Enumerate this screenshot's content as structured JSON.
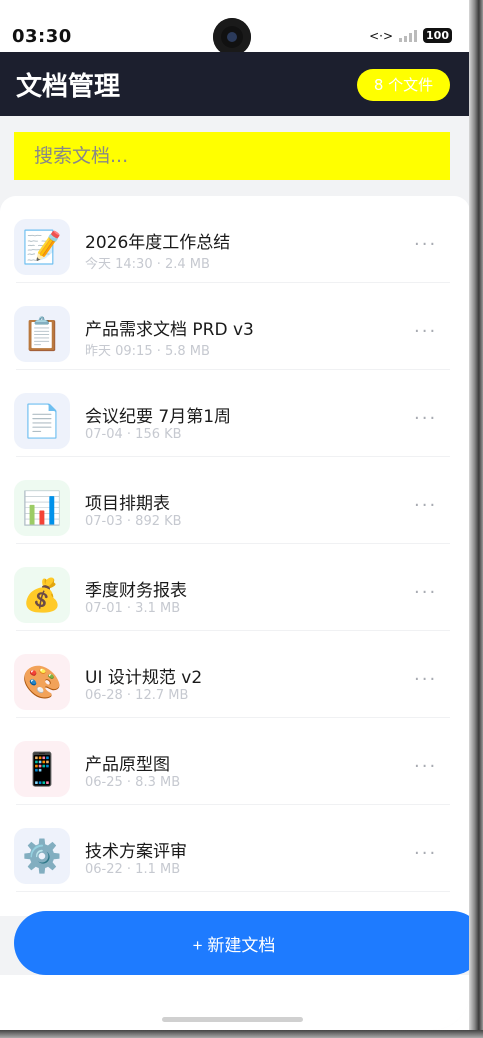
{
  "status_bar": {
    "time": "03:30",
    "signal_prefix": "<·>",
    "battery": "100"
  },
  "header": {
    "title": "文档管理",
    "file_count": "8 个文件"
  },
  "search": {
    "placeholder": "搜索文档..."
  },
  "files": [
    {
      "name": "2026年度工作总结",
      "meta": "今天 14:30 · 2.4 MB",
      "icon": "memo-icon",
      "glyph": "📝",
      "tint": "#eef2fb"
    },
    {
      "name": "产品需求文档 PRD v3",
      "meta": "昨天 09:15 · 5.8 MB",
      "icon": "clipboard-icon",
      "glyph": "📋",
      "tint": "#eef2fb"
    },
    {
      "name": "会议纪要 7月第1周",
      "meta": "07-04 · 156 KB",
      "icon": "page-icon",
      "glyph": "📄",
      "tint": "#eef2fb"
    },
    {
      "name": "项目排期表",
      "meta": "07-03 · 892 KB",
      "icon": "bar-chart-icon",
      "glyph": "📊",
      "tint": "#eefaf1"
    },
    {
      "name": "季度财务报表",
      "meta": "07-01 · 3.1 MB",
      "icon": "money-bag-icon",
      "glyph": "💰",
      "tint": "#eefaf1"
    },
    {
      "name": "UI 设计规范 v2",
      "meta": "06-28 · 12.7 MB",
      "icon": "palette-icon",
      "glyph": "🎨",
      "tint": "#fdf0f3"
    },
    {
      "name": "产品原型图",
      "meta": "06-25 · 8.3 MB",
      "icon": "mobile-phone-icon",
      "glyph": "📱",
      "tint": "#fdf0f3"
    },
    {
      "name": "技术方案评审",
      "meta": "06-22 · 1.1 MB",
      "icon": "gear-icon",
      "glyph": "⚙️",
      "tint": "#eef2fb"
    }
  ],
  "more_label": "···",
  "new_button": {
    "label": "+ 新建文档"
  }
}
